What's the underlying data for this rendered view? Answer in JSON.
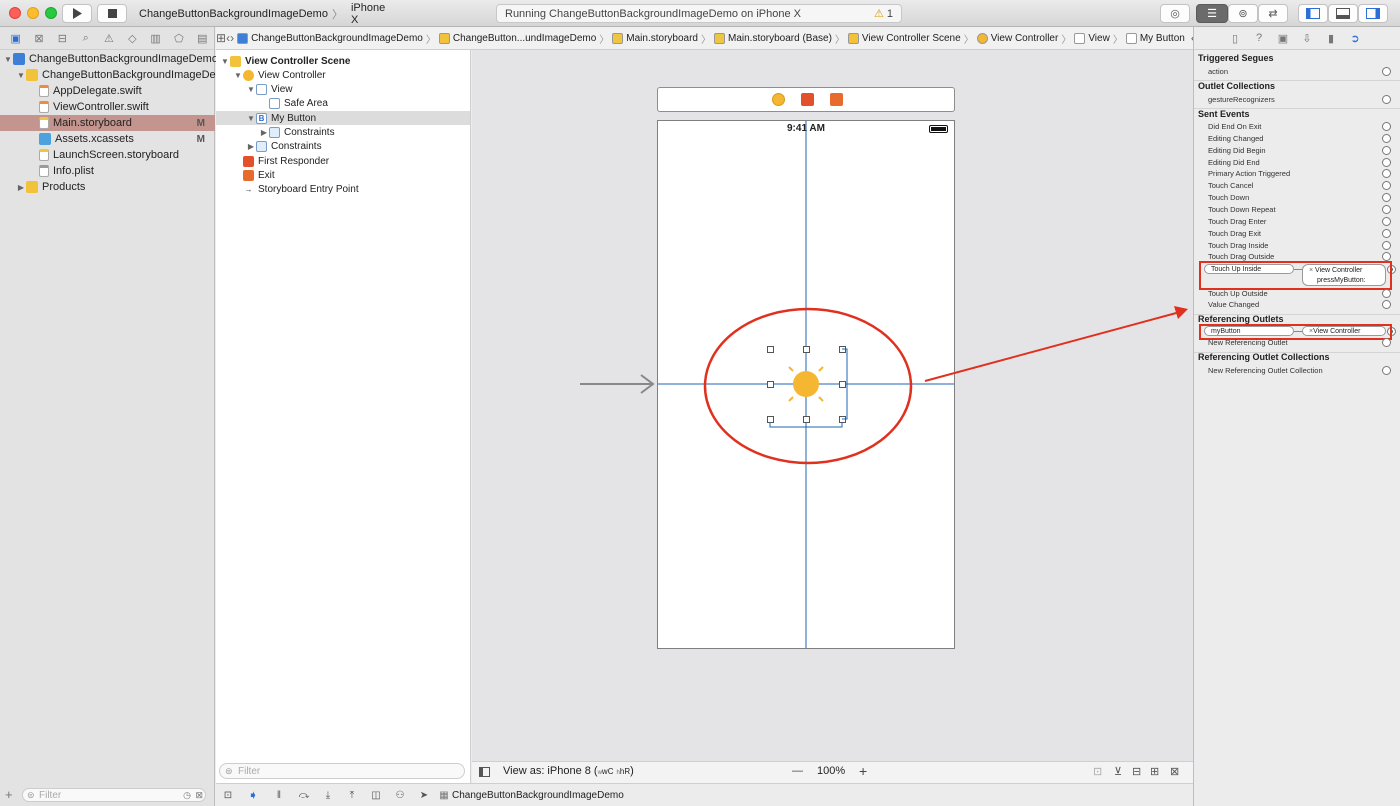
{
  "toolbar": {
    "scheme_target": "ChangeButtonBackgroundImageDemo",
    "device": "iPhone X",
    "status": "Running ChangeButtonBackgroundImageDemo on iPhone X",
    "warning_count": "1"
  },
  "navigator": {
    "files": [
      {
        "label": "ChangeButtonBackgroundImageDemo",
        "icon": "project-icon",
        "indent": 0,
        "disclosure": "▼",
        "badge": ""
      },
      {
        "label": "ChangeButtonBackgroundImageDemo",
        "icon": "folder-icon",
        "indent": 1,
        "disclosure": "▼",
        "badge": ""
      },
      {
        "label": "AppDelegate.swift",
        "icon": "swift-file-icon",
        "indent": 2,
        "disclosure": "",
        "badge": ""
      },
      {
        "label": "ViewController.swift",
        "icon": "swift-file-icon",
        "indent": 2,
        "disclosure": "",
        "badge": ""
      },
      {
        "label": "Main.storyboard",
        "icon": "storyboard-icon",
        "indent": 2,
        "disclosure": "",
        "badge": "M",
        "selected": true
      },
      {
        "label": "Assets.xcassets",
        "icon": "assets-icon",
        "indent": 2,
        "disclosure": "",
        "badge": "M"
      },
      {
        "label": "LaunchScreen.storyboard",
        "icon": "storyboard-icon",
        "indent": 2,
        "disclosure": "",
        "badge": ""
      },
      {
        "label": "Info.plist",
        "icon": "plist-icon",
        "indent": 2,
        "disclosure": "",
        "badge": ""
      },
      {
        "label": "Products",
        "icon": "folder-icon",
        "indent": 1,
        "disclosure": "▶",
        "badge": ""
      }
    ],
    "filter_placeholder": "Filter"
  },
  "jumpbar": {
    "crumbs": [
      "ChangeButtonBackgroundImageDemo",
      "ChangeButton...undImageDemo",
      "Main.storyboard",
      "Main.storyboard (Base)",
      "View Controller Scene",
      "View Controller",
      "View",
      "My Button"
    ]
  },
  "outline": {
    "rows": [
      {
        "label": "View Controller Scene",
        "level": 0,
        "disclosure": "▼",
        "icon": "scene-icon",
        "bold": true
      },
      {
        "label": "View Controller",
        "level": 1,
        "disclosure": "▼",
        "icon": "view-controller-icon"
      },
      {
        "label": "View",
        "level": 2,
        "disclosure": "▼",
        "icon": "view-icon"
      },
      {
        "label": "Safe Area",
        "level": 3,
        "disclosure": "",
        "icon": "safe-area-icon"
      },
      {
        "label": "My Button",
        "level": 2,
        "disclosure": "▼",
        "icon": "button-icon",
        "selected": true
      },
      {
        "label": "Constraints",
        "level": 3,
        "disclosure": "▶",
        "icon": "constraints-icon"
      },
      {
        "label": "Constraints",
        "level": 2,
        "disclosure": "▶",
        "icon": "constraints-icon"
      },
      {
        "label": "First Responder",
        "level": 1,
        "disclosure": "",
        "icon": "first-responder-icon"
      },
      {
        "label": "Exit",
        "level": 1,
        "disclosure": "",
        "icon": "exit-icon"
      },
      {
        "label": "Storyboard Entry Point",
        "level": 1,
        "disclosure": "",
        "icon": "entry-point-arrow-icon"
      }
    ],
    "filter_placeholder": "Filter"
  },
  "canvas": {
    "status_time": "9:41 AM",
    "view_as": "View as: iPhone 8 (",
    "size_class_w": "wC",
    "size_class_h": "hR",
    "size_class_close": ")",
    "zoom": "100%",
    "zoom_out": "—",
    "zoom_in": "+"
  },
  "debugbar": {
    "target": "ChangeButtonBackgroundImageDemo"
  },
  "inspector": {
    "sections": {
      "triggered_segues": "Triggered Segues",
      "outlet_collections": "Outlet Collections",
      "sent_events": "Sent Events",
      "referencing_outlets": "Referencing Outlets",
      "referencing_outlet_collections": "Referencing Outlet Collections"
    },
    "segue_action": "action",
    "gesture": "gestureRecognizers",
    "events": [
      "Did End On Exit",
      "Editing Changed",
      "Editing Did Begin",
      "Editing Did End",
      "Primary Action Triggered",
      "Touch Cancel",
      "Touch Down",
      "Touch Down Repeat",
      "Touch Drag Enter",
      "Touch Drag Exit",
      "Touch Drag Inside",
      "Touch Drag Outside"
    ],
    "touch_up_inside": {
      "event": "Touch Up Inside",
      "target": "View Controller",
      "action": "pressMyButton:"
    },
    "touch_up_outside": "Touch Up Outside",
    "value_changed": "Value Changed",
    "outlet": {
      "name": "myButton",
      "target": "View Controller"
    },
    "new_outlet": "New Referencing Outlet",
    "new_outlet_collection": "New Referencing Outlet Collection"
  },
  "annotations": {
    "color": "#e0301e"
  },
  "colors": {
    "accent": "#2b6fd6",
    "selection": "#c4948e",
    "sun": "#f5b731"
  }
}
